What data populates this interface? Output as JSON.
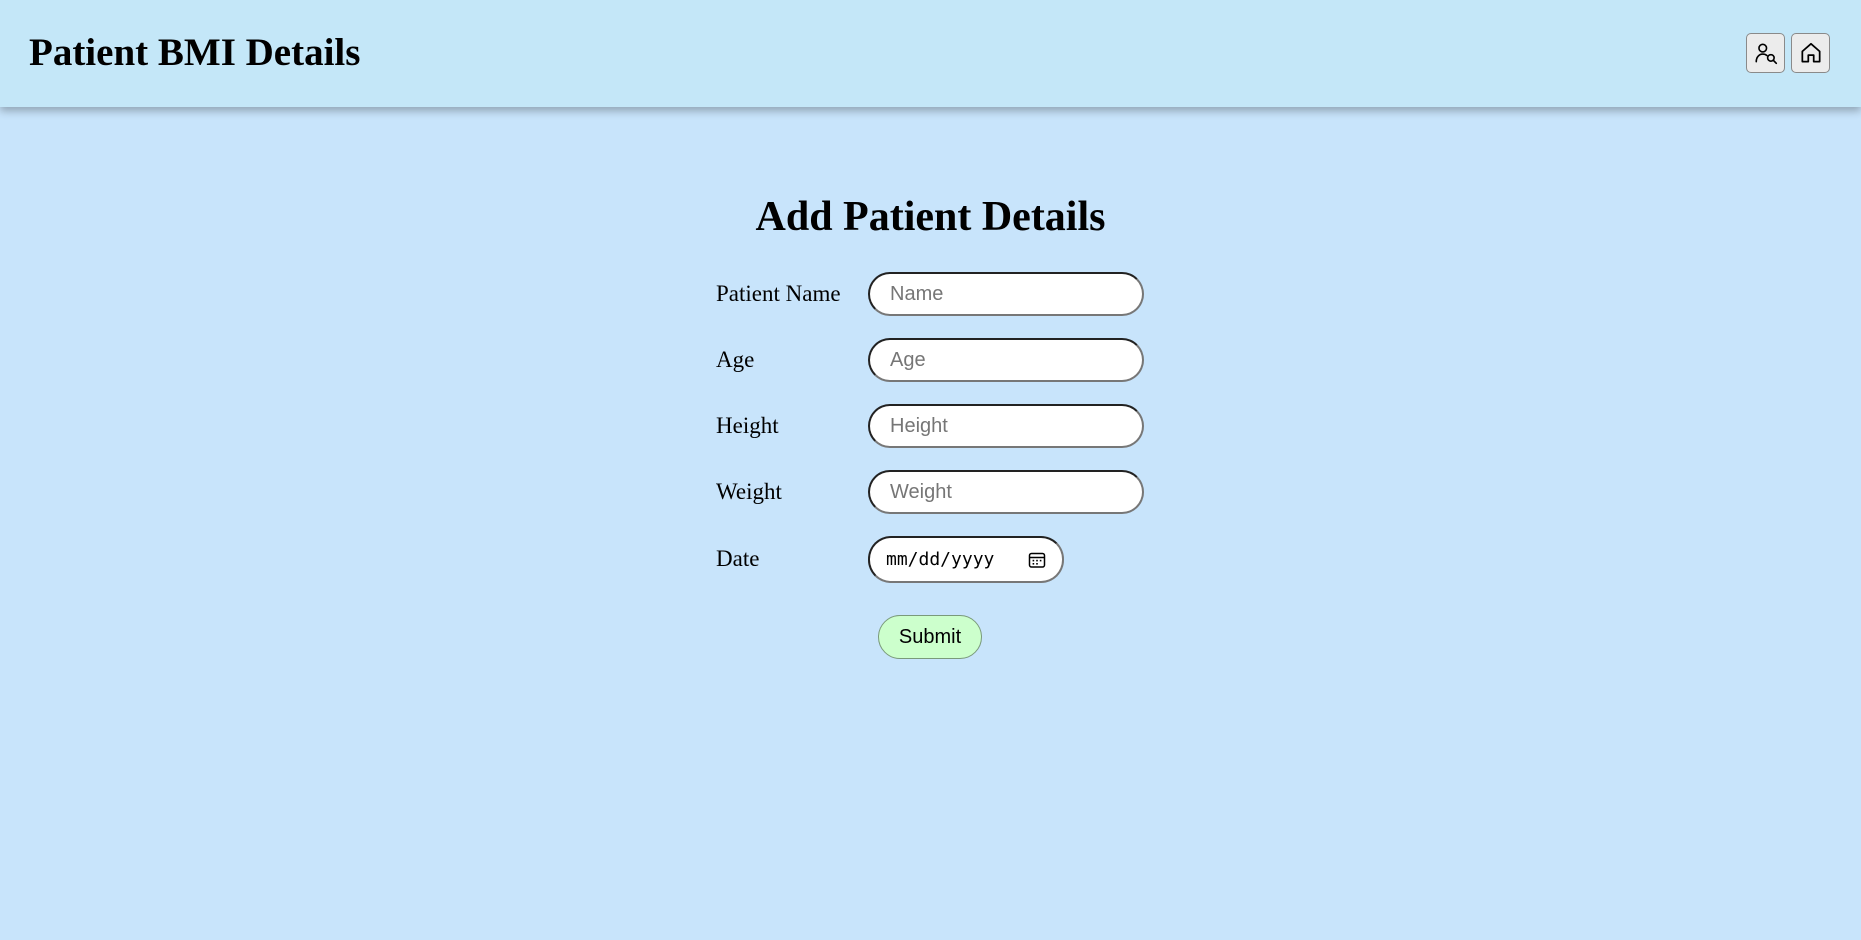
{
  "header": {
    "title": "Patient BMI Details",
    "icons": [
      "user-search-icon",
      "home-icon"
    ]
  },
  "form": {
    "title": "Add Patient Details",
    "fields": [
      {
        "label": "Patient Name",
        "placeholder": "Name",
        "value": ""
      },
      {
        "label": "Age",
        "placeholder": "Age",
        "value": ""
      },
      {
        "label": "Height",
        "placeholder": "Height",
        "value": ""
      },
      {
        "label": "Weight",
        "placeholder": "Weight",
        "value": ""
      }
    ],
    "date": {
      "label": "Date",
      "placeholder": "mm/dd/yyyy",
      "icon": "calendar-icon"
    },
    "submit_label": "Submit"
  },
  "colors": {
    "page_background": "#c8e4fb",
    "header_background": "#c4e7f8",
    "submit_background": "#ccffcc"
  }
}
